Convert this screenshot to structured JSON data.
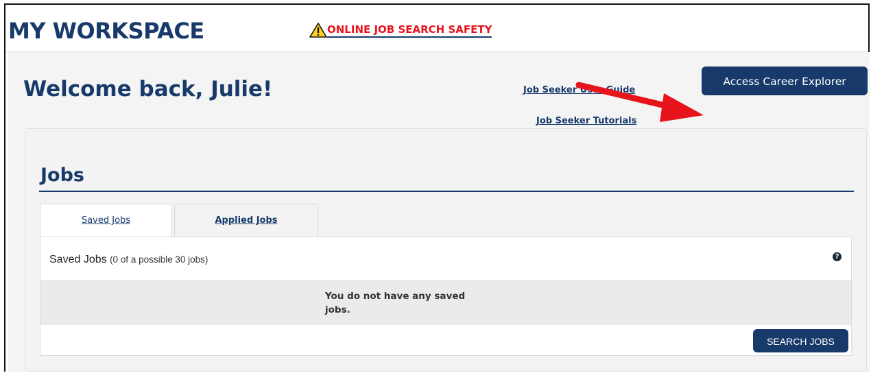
{
  "header": {
    "title": "MY WORKSPACE",
    "safety_link": "ONLINE JOB SEARCH SAFETY",
    "icons": {
      "safety": "warning-triangle-icon"
    }
  },
  "welcome": {
    "heading": "Welcome back, Julie!",
    "user_guide_link": "Job Seeker User Guide",
    "tutorials_link": "Job Seeker Tutorials",
    "career_explorer_button": "Access Career Explorer"
  },
  "jobs": {
    "heading": "Jobs",
    "tabs": [
      {
        "label": "Saved Jobs",
        "active": true
      },
      {
        "label": "Applied Jobs",
        "active": false
      }
    ],
    "saved_header": "Saved Jobs",
    "saved_count": "(0 of a possible 30 jobs)",
    "empty_message": "You do not have any saved jobs.",
    "search_button": "SEARCH JOBS",
    "help_icon": "question-circle-icon"
  },
  "colors": {
    "brand_navy": "#173a6b",
    "warning_red": "#e8141c",
    "annotation_arrow": "#e8141c",
    "panel_bg": "#f3f3f3"
  }
}
